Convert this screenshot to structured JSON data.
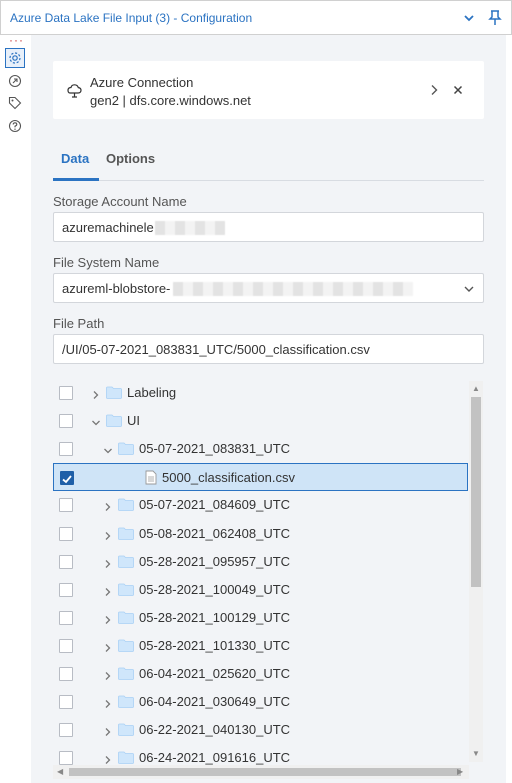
{
  "window": {
    "title": "Azure Data Lake File Input (3) - Configuration"
  },
  "rail": {
    "items": [
      "settings-icon",
      "connections-icon",
      "tag-icon",
      "help-icon"
    ]
  },
  "connection": {
    "title": "Azure Connection",
    "subtitle": "gen2 | dfs.core.windows.net"
  },
  "tabs": [
    {
      "label": "Data",
      "active": true
    },
    {
      "label": "Options",
      "active": false
    }
  ],
  "storage_account": {
    "label": "Storage Account Name",
    "value": "azuremachinele"
  },
  "file_system": {
    "label": "File System Name",
    "value": "azureml-blobstore-"
  },
  "file_path": {
    "label": "File Path",
    "value": "/UI/05-07-2021_083831_UTC/5000_classification.csv"
  },
  "tree": [
    {
      "name": "Labeling",
      "type": "folder",
      "level": 0,
      "expanded": false,
      "checked": false
    },
    {
      "name": "UI",
      "type": "folder",
      "level": 0,
      "expanded": true,
      "checked": false
    },
    {
      "name": "05-07-2021_083831_UTC",
      "type": "folder",
      "level": 1,
      "expanded": true,
      "checked": false
    },
    {
      "name": "5000_classification.csv",
      "type": "file",
      "level": 2,
      "expanded": false,
      "checked": true
    },
    {
      "name": "05-07-2021_084609_UTC",
      "type": "folder",
      "level": 1,
      "expanded": false,
      "checked": false
    },
    {
      "name": "05-08-2021_062408_UTC",
      "type": "folder",
      "level": 1,
      "expanded": false,
      "checked": false
    },
    {
      "name": "05-28-2021_095957_UTC",
      "type": "folder",
      "level": 1,
      "expanded": false,
      "checked": false
    },
    {
      "name": "05-28-2021_100049_UTC",
      "type": "folder",
      "level": 1,
      "expanded": false,
      "checked": false
    },
    {
      "name": "05-28-2021_100129_UTC",
      "type": "folder",
      "level": 1,
      "expanded": false,
      "checked": false
    },
    {
      "name": "05-28-2021_101330_UTC",
      "type": "folder",
      "level": 1,
      "expanded": false,
      "checked": false
    },
    {
      "name": "06-04-2021_025620_UTC",
      "type": "folder",
      "level": 1,
      "expanded": false,
      "checked": false
    },
    {
      "name": "06-04-2021_030649_UTC",
      "type": "folder",
      "level": 1,
      "expanded": false,
      "checked": false
    },
    {
      "name": "06-22-2021_040130_UTC",
      "type": "folder",
      "level": 1,
      "expanded": false,
      "checked": false
    },
    {
      "name": "06-24-2021_091616_UTC",
      "type": "folder",
      "level": 1,
      "expanded": false,
      "checked": false
    }
  ],
  "colors": {
    "accent": "#2b73c2",
    "panel_bg": "#f2f4f7",
    "selected_row": "#cfe4f7",
    "folder": "#cfe6fb",
    "folder_tab": "#a9d0f5"
  }
}
